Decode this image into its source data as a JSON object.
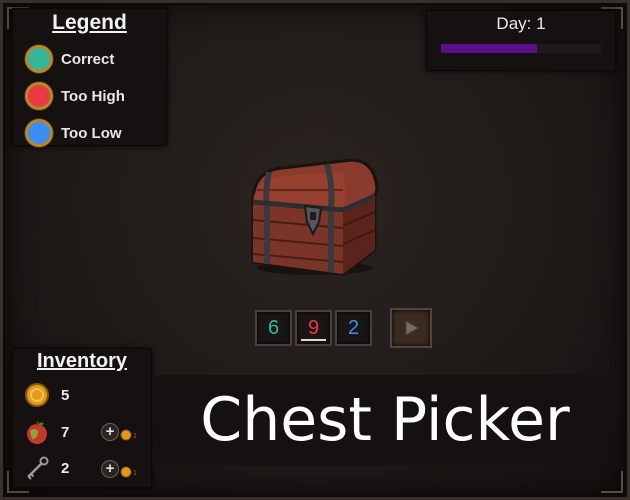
{
  "legend": {
    "title": "Legend",
    "items": [
      {
        "label": "Correct",
        "color": "#34b79a"
      },
      {
        "label": "Too High",
        "color": "#ec3a44"
      },
      {
        "label": "Too Low",
        "color": "#3a8ff0"
      }
    ]
  },
  "day": {
    "label": "Day: 1",
    "progress": 0.6,
    "bar_color": "#5a0f86"
  },
  "guess": {
    "digits": [
      {
        "value": "6",
        "color": "#34b79a",
        "state": "correct"
      },
      {
        "value": "9",
        "color": "#ec3a44",
        "state": "too-high",
        "selected": true
      },
      {
        "value": "2",
        "color": "#3a8ff0",
        "state": "too-low"
      }
    ],
    "submit_icon": "play-icon"
  },
  "inventory": {
    "title": "Inventory",
    "items": [
      {
        "name": "coin",
        "icon": "coin-icon",
        "count": "5"
      },
      {
        "name": "apple",
        "icon": "apple-icon",
        "count": "7",
        "buy_cost": "1"
      },
      {
        "name": "key",
        "icon": "key-icon",
        "count": "2",
        "buy_cost": "1"
      }
    ]
  },
  "title": "Chest Picker"
}
